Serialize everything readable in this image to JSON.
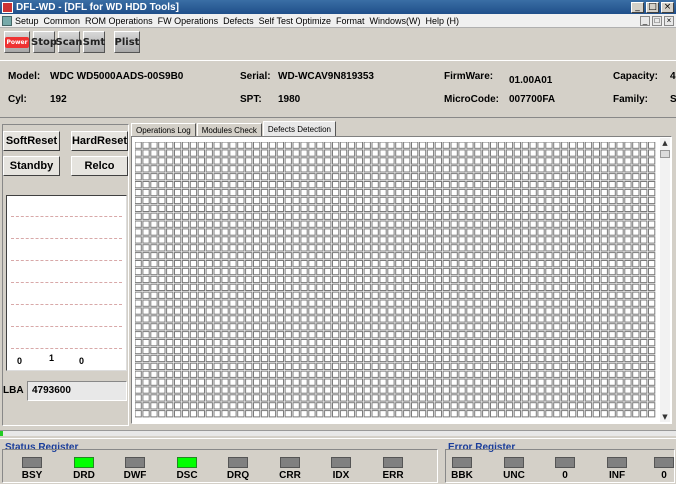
{
  "window": {
    "title": "DFL-WD - [DFL for WD HDD Tools]",
    "controls": [
      "_",
      "□",
      "×"
    ]
  },
  "menu": {
    "items": [
      "Setup",
      "Common",
      "ROM Operations",
      "FW Operations",
      "Defects",
      "Self Test Optimize",
      "Format",
      "Windows(W)",
      "Help (H)"
    ],
    "mdi_controls": [
      "_",
      "□",
      "×"
    ]
  },
  "toolbar": {
    "power": "Power",
    "stop": "Stop",
    "scan": "Scan",
    "smt": "Smt",
    "plist": "Plist"
  },
  "drive": {
    "model_label": "Model:",
    "model": "WDC WD5000AADS-00S9B0",
    "serial_label": "Serial:",
    "serial": "WD-WCAV9N819353",
    "firmware_label": "FirmWare:",
    "firmware": "01.00A01",
    "capacity_label": "Capacity:",
    "capacity": "4",
    "cyl_label": "Cyl:",
    "cyl": "192",
    "spt_label": "SPT:",
    "spt": "1980",
    "microcode_label": "MicroCode:",
    "microcode": "007700FA",
    "family_label": "Family:",
    "family": "S"
  },
  "controls": {
    "soft_reset": "SoftReset",
    "hard_reset": "HardReset",
    "standby": "Standby",
    "relco": "Relco"
  },
  "plot": {
    "ticks": [
      "0",
      "1",
      "0"
    ]
  },
  "lba": {
    "label": "LBA",
    "value": "4793600"
  },
  "tabs": [
    "Operations Log",
    "Modules Check",
    "Defects Detection"
  ],
  "progress": {
    "fraction": 0.005
  },
  "status_register": {
    "title": "Status Register",
    "flags": [
      {
        "name": "BSY",
        "on": false
      },
      {
        "name": "DRD",
        "on": true
      },
      {
        "name": "DWF",
        "on": false
      },
      {
        "name": "DSC",
        "on": true
      },
      {
        "name": "DRQ",
        "on": false
      },
      {
        "name": "CRR",
        "on": false
      },
      {
        "name": "IDX",
        "on": false
      },
      {
        "name": "ERR",
        "on": false
      }
    ]
  },
  "error_register": {
    "title": "Error Register",
    "flags": [
      {
        "name": "BBK",
        "on": false
      },
      {
        "name": "UNC",
        "on": false
      },
      {
        "name": "0",
        "on": false
      },
      {
        "name": "INF",
        "on": false
      },
      {
        "name": "0",
        "on": false
      }
    ]
  }
}
